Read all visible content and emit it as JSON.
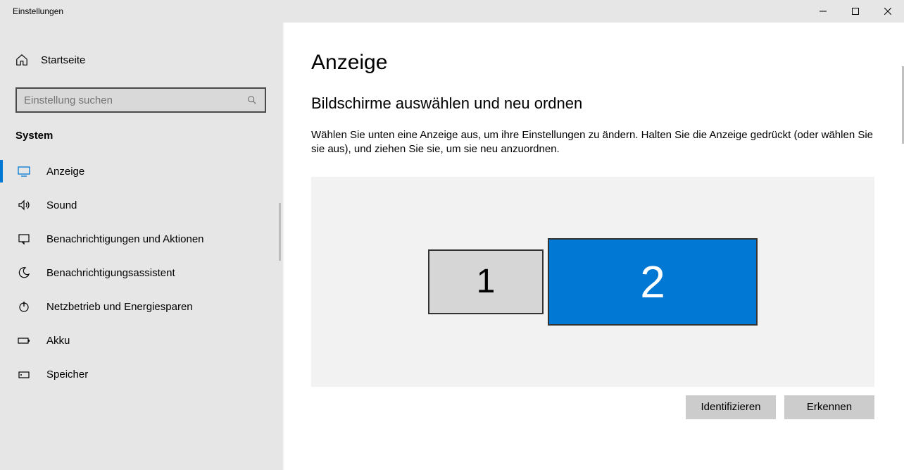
{
  "window": {
    "title": "Einstellungen"
  },
  "sidebar": {
    "home": "Startseite",
    "search_placeholder": "Einstellung suchen",
    "category": "System",
    "items": [
      {
        "label": "Anzeige",
        "icon": "monitor"
      },
      {
        "label": "Sound",
        "icon": "sound"
      },
      {
        "label": "Benachrichtigungen und Aktionen",
        "icon": "notifications"
      },
      {
        "label": "Benachrichtigungsassistent",
        "icon": "moon"
      },
      {
        "label": "Netzbetrieb und Energiesparen",
        "icon": "power"
      },
      {
        "label": "Akku",
        "icon": "battery"
      },
      {
        "label": "Speicher",
        "icon": "storage"
      }
    ]
  },
  "content": {
    "page_title": "Anzeige",
    "section_title": "Bildschirme auswählen und neu ordnen",
    "section_desc": "Wählen Sie unten eine Anzeige aus, um ihre Einstellungen zu ändern. Halten Sie die Anzeige gedrückt (oder wählen Sie sie aus), und ziehen Sie sie, um sie neu anzuordnen.",
    "monitors": {
      "m1": "1",
      "m2": "2"
    },
    "buttons": {
      "identify": "Identifizieren",
      "detect": "Erkennen"
    }
  }
}
